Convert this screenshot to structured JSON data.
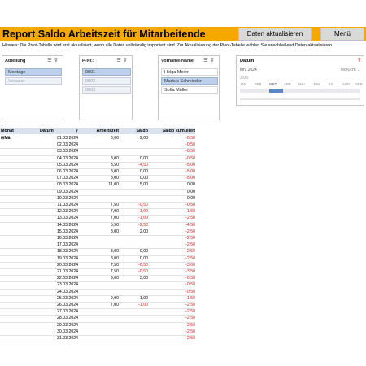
{
  "header": {
    "title": "Report Saldo Arbeitszeit für Mitarbeitende",
    "refresh_button": "Daten aktualisieren",
    "menu_button": "Menü",
    "hint": "Hinweis: Die Pivot-Tabelle wird erst aktualisiert, wenn alle Daten vollständig importiert sind. Zur Aktualisierung der Pivot-Tabelle wählen Sie anschließend Daten aktualisieren"
  },
  "slicers": {
    "abteilung": {
      "title": "Abteilung",
      "items": [
        "Montage",
        "Versand"
      ]
    },
    "pnr": {
      "title": "P-Nr.:",
      "items": [
        "0001",
        "0002",
        "0003"
      ]
    },
    "name": {
      "title": "Vorname-Name",
      "items": [
        "Helga Meier",
        "Markus Schmieder",
        "Sofia Müller"
      ]
    }
  },
  "timeline": {
    "title": "Datum",
    "period": "Mrz 2024",
    "level": "MONATE",
    "year": "2024",
    "months": [
      "JAN",
      "FEB",
      "MRZ",
      "APR",
      "MAI",
      "JUN",
      "JUL",
      "AUG",
      "SEP"
    ]
  },
  "table": {
    "headers": {
      "monat": "Monat",
      "datum": "Datum",
      "arbeitszeit": "Arbeitszeit",
      "saldo": "Saldo",
      "kumuliert": "Saldo kumuliert"
    },
    "group": "Mär",
    "rows": [
      [
        "01.03.2024",
        "8,00",
        "2,00",
        "-0,50"
      ],
      [
        "02.03.2024",
        "",
        "",
        "-0,50"
      ],
      [
        "03.03.2024",
        "",
        "",
        "-0,50"
      ],
      [
        "04.03.2024",
        "8,00",
        "0,00",
        "-0,50"
      ],
      [
        "05.03.2024",
        "3,50",
        "-4,50",
        "-5,00"
      ],
      [
        "06.03.2024",
        "8,00",
        "0,00",
        "-5,00"
      ],
      [
        "07.03.2024",
        "8,00",
        "0,00",
        "-5,00"
      ],
      [
        "08.03.2024",
        "11,00",
        "5,00",
        "0,00"
      ],
      [
        "09.03.2024",
        "",
        "",
        "0,00"
      ],
      [
        "10.03.2024",
        "",
        "",
        "0,00"
      ],
      [
        "11.03.2024",
        "7,50",
        "-0,50",
        "-0,50"
      ],
      [
        "12.03.2024",
        "7,00",
        "-1,00",
        "-1,50"
      ],
      [
        "13.03.2024",
        "7,00",
        "-1,00",
        "-2,50"
      ],
      [
        "14.03.2024",
        "5,50",
        "-2,50",
        "-4,50"
      ],
      [
        "15.03.2024",
        "8,00",
        "2,00",
        "-2,50"
      ],
      [
        "16.03.2024",
        "",
        "",
        "-2,50"
      ],
      [
        "17.03.2024",
        "",
        "",
        "-2,50"
      ],
      [
        "18.03.2024",
        "8,00",
        "0,00",
        "-2,50"
      ],
      [
        "19.03.2024",
        "8,00",
        "0,00",
        "-2,50"
      ],
      [
        "20.03.2024",
        "7,50",
        "-0,50",
        "-3,00"
      ],
      [
        "21.03.2024",
        "7,50",
        "-0,50",
        "-3,50"
      ],
      [
        "22.03.2024",
        "9,00",
        "3,00",
        "-0,50"
      ],
      [
        "23.03.2024",
        "",
        "",
        "-0,50"
      ],
      [
        "24.03.2024",
        "",
        "",
        "-0,50"
      ],
      [
        "25.03.2024",
        "9,00",
        "1,00",
        "-1,50"
      ],
      [
        "26.03.2024",
        "7,00",
        "-1,00",
        "-2,50"
      ],
      [
        "27.03.2024",
        "",
        "",
        "-2,50"
      ],
      [
        "28.03.2024",
        "",
        "",
        "-2,50"
      ],
      [
        "29.03.2024",
        "",
        "",
        "-2,50"
      ],
      [
        "30.03.2024",
        "",
        "",
        "-2,50"
      ],
      [
        "31.03.2024",
        "",
        "",
        "-2,50"
      ]
    ]
  }
}
